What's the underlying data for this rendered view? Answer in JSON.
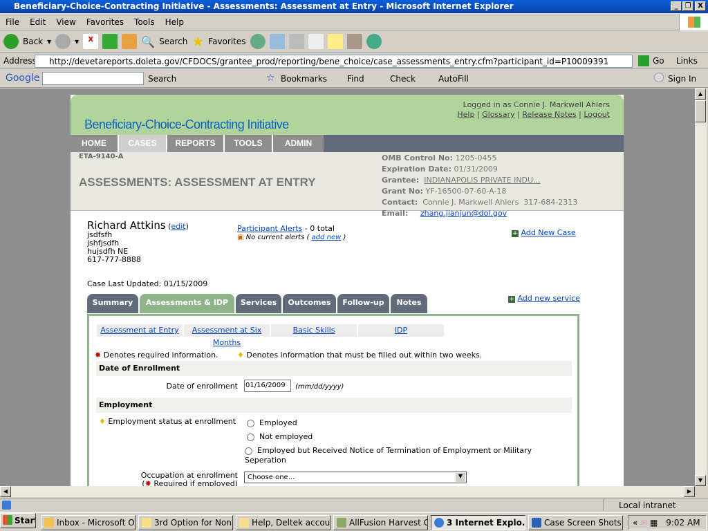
{
  "window": {
    "title": "Beneficiary-Choice-Contracting Initiative - Assessments: Assessment at Entry - Microsoft Internet Explorer"
  },
  "menu": [
    "File",
    "Edit",
    "View",
    "Favorites",
    "Tools",
    "Help"
  ],
  "toolbar": {
    "back": "Back",
    "search": "Search",
    "favorites": "Favorites"
  },
  "address": {
    "label": "Address",
    "url": "http://devetareports.doleta.gov/CFDOCS/grantee_prod/reporting/bene_choice/case_assessments_entry.cfm?participant_id=P10009391",
    "go": "Go",
    "links": "Links"
  },
  "google": {
    "logo": "Google",
    "search": "Search",
    "bookmarks": "Bookmarks",
    "find": "Find",
    "check": "Check",
    "autofill": "AutoFill",
    "signin": "Sign In"
  },
  "header": {
    "brand": "Beneficiary-Choice-Contracting Initiative",
    "logged_in": "Logged in as Connie J. Markwell Ahlers",
    "links": [
      "Help",
      "Glossary",
      "Release Notes",
      "Logout"
    ]
  },
  "nav": [
    "HOME",
    "CASES",
    "REPORTS",
    "TOOLS",
    "ADMIN"
  ],
  "info": {
    "form_id": "ETA-9140-A",
    "title": "ASSESSMENTS: ASSESSMENT AT ENTRY",
    "omb_label": "OMB Control No:",
    "omb": "1205-0455",
    "exp_label": "Expiration Date:",
    "exp": "01/31/2009",
    "grantee_label": "Grantee:",
    "grantee": "INDIANAPOLIS PRIVATE INDU...",
    "grant_label": "Grant No:",
    "grant": "YF-16500-07-60-A-18",
    "contact_label": "Contact:",
    "contact": "Connie J. Markwell Ahlers  317-684-2313",
    "email_label": "Email:",
    "email": "zhang.jianjun@dol.gov"
  },
  "participant": {
    "name": "Richard Attkins",
    "edit": "edit",
    "lines": [
      "jsdfsfh",
      "jshfjsdfh",
      "hujsdfh NE",
      "617-777-8888"
    ],
    "alerts_link": "Participant Alerts",
    "alerts_total": "- 0 total",
    "no_alerts": "No current alerts (",
    "add_new": "add new",
    "close_paren": ")",
    "add_case": "Add New Case",
    "last_updated": "Case Last Updated: 01/15/2009",
    "add_service": "Add new service"
  },
  "tabs": [
    "Summary",
    "Assessments & IDP",
    "Services",
    "Outcomes",
    "Follow-up",
    "Notes"
  ],
  "subtabs": [
    "Assessment at Entry",
    "Assessment at Six Months",
    "Basic Skills",
    "IDP"
  ],
  "form": {
    "req_note": "Denotes required information.",
    "two_weeks_note": "Denotes information that must be filled out within two weeks.",
    "sec_enroll": "Date of Enrollment",
    "date_label": "Date of enrollment",
    "date_value": "01/16/2009",
    "date_format": "(mm/dd/yyyy)",
    "sec_employment": "Employment",
    "emp_status_label": "Employment status at enrollment",
    "emp_options": [
      "Employed",
      "Not employed",
      "Employed but Received Notice of Termination of Employment or Military Seperation"
    ],
    "occupation_label": "Occupation at enrollment",
    "occupation_note": "Required if employed)",
    "occupation_value": "Choose one..."
  },
  "status": {
    "zone": "Local intranet"
  },
  "taskbar": {
    "start": "Start",
    "tasks": [
      "Inbox - Microsoft O...",
      "3rd Option for Non-...",
      "Help, Deltek accoun...",
      "AllFusion Harvest C...",
      "3 Internet Explo...",
      "Case Screen Shots...."
    ],
    "time": "9:02 AM"
  }
}
